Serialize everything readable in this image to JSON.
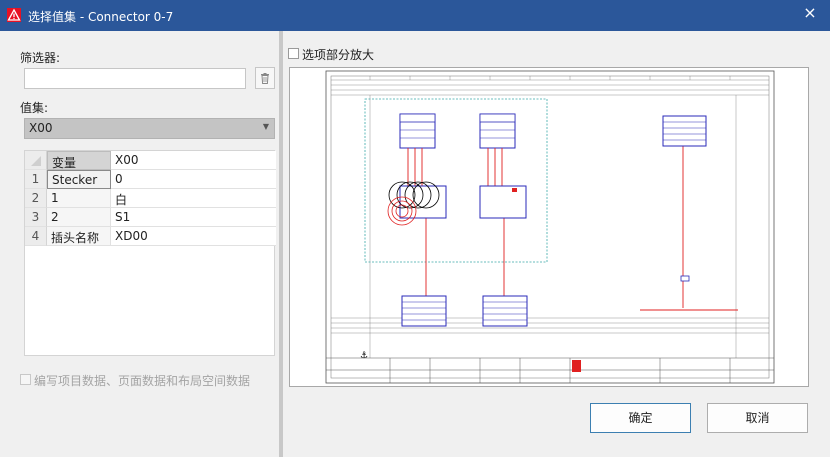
{
  "window": {
    "title": "选择值集 - Connector 0-7",
    "close_glyph": "×"
  },
  "left_panel": {
    "filter_label": "筛选器:",
    "filter_value": "",
    "valueset_label": "值集:",
    "valueset_selected": "X00",
    "grid": {
      "header": {
        "col1": "变量",
        "col2": "X00"
      },
      "rows": [
        {
          "num": "1",
          "variable": "Stecker",
          "value": "0"
        },
        {
          "num": "2",
          "variable": "1",
          "value": "白"
        },
        {
          "num": "3",
          "variable": "2",
          "value": "S1"
        },
        {
          "num": "4",
          "variable": "插头名称",
          "value": "XD00"
        }
      ]
    },
    "checkbox_label": "编写项目数据、页面数据和布局空间数据"
  },
  "right_panel": {
    "zoom_checkbox_label": "选项部分放大"
  },
  "buttons": {
    "ok": "确定",
    "cancel": "取消"
  },
  "colors": {
    "titlebar": "#2b579a",
    "accent_red": "#e81123",
    "schematic_blue": "#2a2ab8",
    "schematic_red": "#e02020",
    "dashed_teal": "#3aa8a8"
  }
}
